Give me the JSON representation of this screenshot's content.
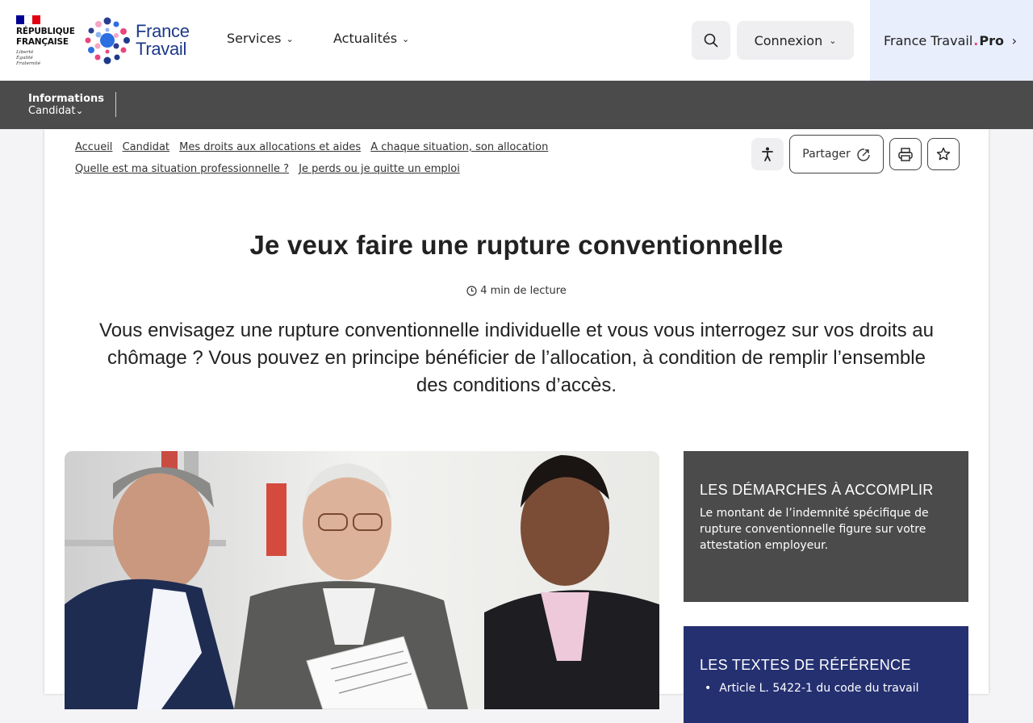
{
  "header": {
    "republique": "RÉPUBLIQUE\nFRANÇAISE",
    "motto": "Liberté\nÉgalité\nFraternité",
    "flag_colors": [
      "#000091",
      "#ffffff",
      "#e1000f"
    ],
    "logo_text": "France\nTravail",
    "nav": [
      {
        "label": "Services",
        "icon": "chevron-down-icon"
      },
      {
        "label": "Actualités",
        "icon": "chevron-down-icon"
      }
    ],
    "search_icon": "search-icon",
    "login_label": "Connexion",
    "pro": {
      "brand": "France Travail",
      "dot": ".",
      "pro": "Pro",
      "icon": "chevron-right-icon"
    }
  },
  "subbar": {
    "line1": "Informations",
    "line2": "Candidat"
  },
  "breadcrumb": [
    "Accueil",
    "Candidat",
    "Mes droits aux allocations et aides",
    "A chaque situation, son allocation",
    "Quelle est ma situation professionnelle ?",
    "Je perds ou je quitte un emploi"
  ],
  "tools": {
    "share_label": "Partager"
  },
  "article": {
    "title": "Je veux faire une rupture conventionnelle",
    "read_time": "4 min de lecture",
    "lead": "Vous envisagez une rupture conventionnelle individuelle et vous vous interrogez sur vos droits au chômage ? Vous pouvez en principe bénéficier de l’allocation, à condition de remplir l’ensemble des conditions d’accès."
  },
  "sidebar": {
    "demarches": {
      "title": "LES DÉMARCHES À ACCOMPLIR",
      "text": "Le montant de l’indemnité spécifique de rupture conventionnelle figure sur votre attestation employeur."
    },
    "textes": {
      "title": "LES TEXTES DE RÉFÉRENCE",
      "items": [
        "Article L. 5422-1 du code du travail"
      ]
    }
  },
  "colors": {
    "accent_blue": "#253071",
    "dark_grey": "#4b4b4b",
    "pro_bg": "#e8eefc",
    "pro_dot": "#e8467c"
  }
}
